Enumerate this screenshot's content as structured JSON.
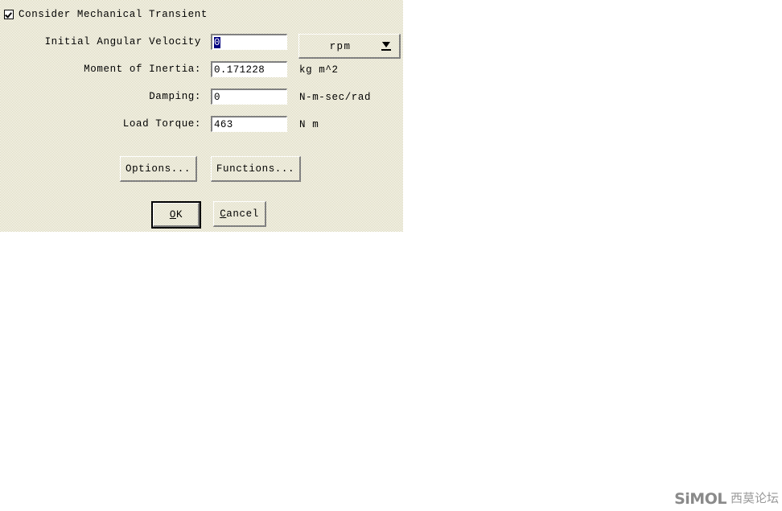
{
  "dialog": {
    "consider_checkbox": {
      "label": "Consider Mechanical Transient",
      "checked": true
    },
    "fields": [
      {
        "label": "Initial Angular Velocity",
        "value": "0",
        "selected": true,
        "unit": "rpm",
        "unit_is_dropdown": true
      },
      {
        "label": "Moment of Inertia:",
        "value": "0.171228",
        "selected": false,
        "unit": "kg m^2",
        "unit_is_dropdown": false
      },
      {
        "label": "Damping:",
        "value": "0",
        "selected": false,
        "unit": "N-m-sec/rad",
        "unit_is_dropdown": false
      },
      {
        "label": "Load Torque:",
        "value": "463",
        "selected": false,
        "unit": "N m",
        "unit_is_dropdown": false
      }
    ],
    "unit_dropdown": {
      "selected": "rpm",
      "arrow_icon": "chevron-down-icon"
    },
    "buttons": {
      "options": "Options...",
      "functions": "Functions...",
      "ok_accel": "O",
      "ok_rest": "K",
      "cancel_accel": "C",
      "cancel_rest": "ancel"
    }
  },
  "watermark": {
    "latin": "SiMOL",
    "cjk": "西莫论坛"
  },
  "colors": {
    "dialog_face": "#d6d2b0",
    "selection": "#000080",
    "shadow": "#808080",
    "highlight": "#ffffff",
    "text": "#000000"
  }
}
